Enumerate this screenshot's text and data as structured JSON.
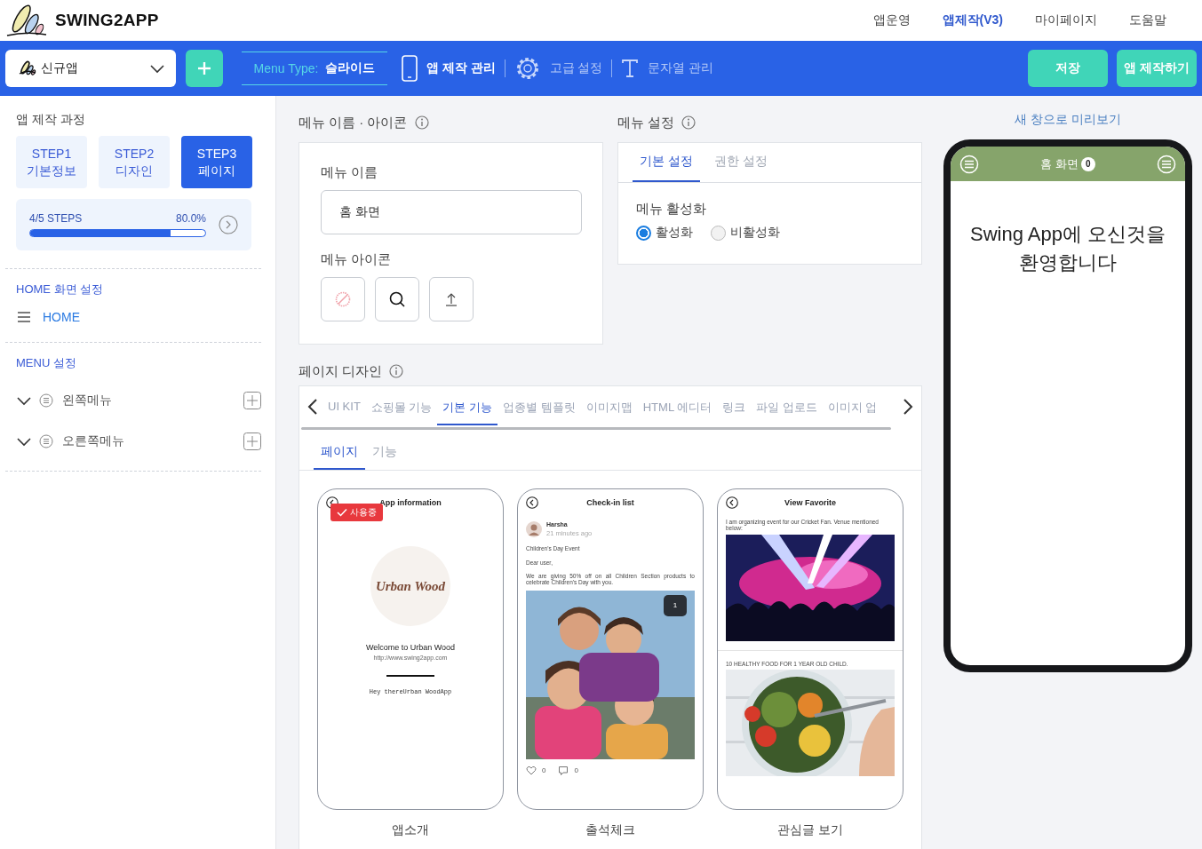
{
  "header": {
    "brand": "SWING2APP",
    "nav": [
      {
        "label": "앱운영",
        "selected": false
      },
      {
        "label": "앱제작(V3)",
        "selected": true
      },
      {
        "label": "마이페이지",
        "selected": false
      },
      {
        "label": "도움말",
        "selected": false
      }
    ]
  },
  "toolbar": {
    "app_select": "신규앱",
    "menu_type_label": "Menu Type:",
    "menu_type_value": "슬라이드",
    "tools": [
      {
        "kind": "phone",
        "label": "앱 제작 관리",
        "selected": true
      },
      {
        "kind": "gear",
        "label": "고급 설정",
        "selected": false
      },
      {
        "kind": "text",
        "label": "문자열 관리",
        "selected": false
      }
    ],
    "buttons": [
      "저장",
      "앱 제작하기"
    ]
  },
  "sidebar": {
    "process_title": "앱 제작 과정",
    "steps": [
      {
        "step": "STEP1",
        "label": "기본정보",
        "selected": false
      },
      {
        "step": "STEP2",
        "label": "디자인",
        "selected": false
      },
      {
        "step": "STEP3",
        "label": "페이지",
        "selected": true
      }
    ],
    "progress": {
      "label": "4/5 STEPS",
      "reading": "80.0%",
      "level": 0.8
    },
    "home_title": "HOME 화면 설정",
    "home_item": "HOME",
    "menu_title": "MENU 설정",
    "menus": [
      "왼쪽메뉴",
      "오른쪽메뉴"
    ]
  },
  "menu_name_panel": {
    "title": "메뉴 이름 · 아이콘",
    "name_label": "메뉴 이름",
    "name_value": "홈 화면",
    "icon_label": "메뉴 아이콘",
    "icon_choices": [
      {
        "kind": "none"
      },
      {
        "kind": "search"
      },
      {
        "kind": "upload"
      }
    ]
  },
  "menu_settings": {
    "title": "메뉴 설정",
    "tabs": [
      {
        "label": "기본 설정",
        "selected": true
      },
      {
        "label": "권한 설정",
        "selected": false
      }
    ],
    "field_label": "메뉴 활성화",
    "options": [
      {
        "label": "활성화",
        "selected": true
      },
      {
        "label": "비활성화",
        "selected": false
      }
    ]
  },
  "page_design": {
    "title": "페이지 디자인",
    "categories": [
      {
        "label": "UI KIT",
        "selected": false
      },
      {
        "label": "쇼핑몰 기능",
        "selected": false
      },
      {
        "label": "기본 기능",
        "selected": true
      },
      {
        "label": "업종별 템플릿",
        "selected": false
      },
      {
        "label": "이미지맵",
        "selected": false
      },
      {
        "label": "HTML 에디터",
        "selected": false
      },
      {
        "label": "링크",
        "selected": false
      },
      {
        "label": "파일 업로드",
        "selected": false
      },
      {
        "label": "이미지 업",
        "selected": false
      }
    ],
    "subtabs": [
      {
        "label": "페이지",
        "selected": true
      },
      {
        "label": "기능",
        "selected": false
      }
    ],
    "templates": [
      {
        "kind": "about",
        "in_use": true,
        "badge": "사용중",
        "screen_title": "App information",
        "logo_text": "Urban Wood",
        "welcome": "Welcome to Urban Wood",
        "url": "http://www.swing2app.com",
        "message": "Hey thereUrban WoodApp",
        "caption": "앱소개"
      },
      {
        "kind": "checkin",
        "in_use": false,
        "screen_title": "Check-in list",
        "author": "Harsha",
        "time": "21 minutes ago",
        "heading": "Children's Day Event",
        "greeting": "Dear user,",
        "body": "We are giving 50% off on all Children Section products to celebrate Children's Day with you.",
        "photo_badge": "1",
        "likes": "0",
        "comments": "0",
        "caption": "출석체크"
      },
      {
        "kind": "favorite",
        "in_use": false,
        "screen_title": "View Favorite",
        "post_text": "I am organizing event for our Cricket Fan. Venue mentioned below:",
        "post2_text": "10 HEALTHY FOOD FOR 1 YEAR OLD CHILD.",
        "caption": "관심글 보기"
      }
    ]
  },
  "preview": {
    "link": "새 창으로 미리보기",
    "title": "홈 화면",
    "badge": "0",
    "welcome": "Swing App에 오신것을 환영합니다"
  }
}
